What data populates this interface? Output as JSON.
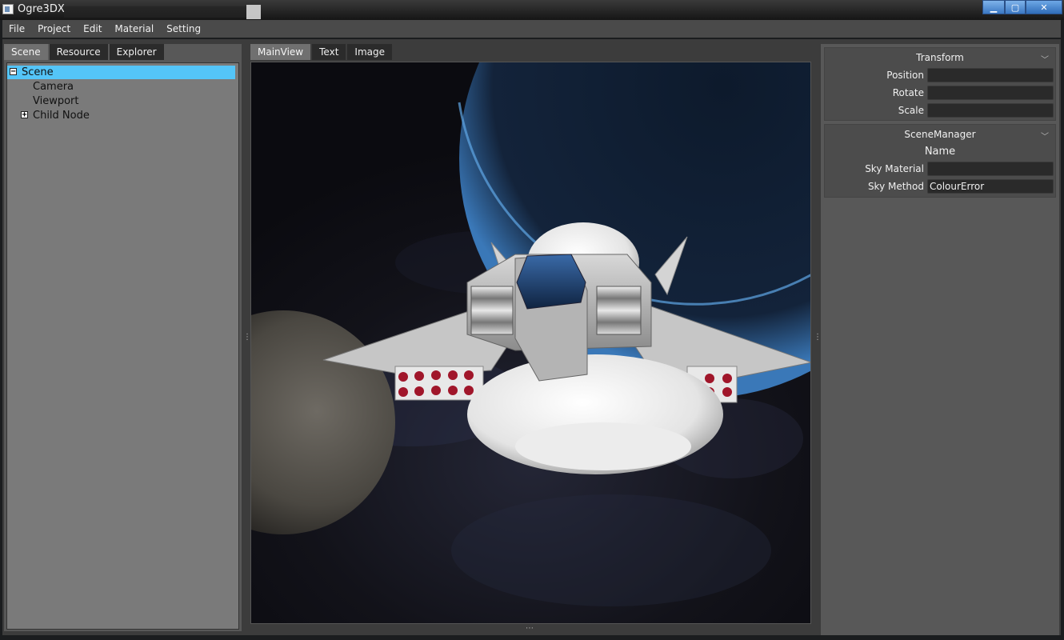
{
  "window": {
    "title": "Ogre3DX",
    "controls": {
      "minimize_icon": "minimize-icon",
      "maximize_icon": "maximize-icon",
      "close_icon": "close-icon",
      "close_glyph": "✕",
      "min_glyph": "▁",
      "max_glyph": "▢"
    }
  },
  "menu": [
    "File",
    "Project",
    "Edit",
    "Material",
    "Setting"
  ],
  "left_panel": {
    "tabs": [
      "Scene",
      "Resource",
      "Explorer"
    ],
    "active_tab": "Scene",
    "tree": [
      {
        "label": "Scene",
        "toggle": "−",
        "selected": true
      },
      {
        "label": "Camera"
      },
      {
        "label": "Viewport"
      },
      {
        "label": "Child Node",
        "toggle": "+"
      }
    ]
  },
  "center_panel": {
    "tabs": [
      "MainView",
      "Text",
      "Image"
    ],
    "active_tab": "MainView"
  },
  "right_panel": {
    "transform": {
      "title": "Transform",
      "fields": [
        {
          "label": "Position",
          "value": ""
        },
        {
          "label": "Rotate",
          "value": ""
        },
        {
          "label": "Scale",
          "value": ""
        }
      ]
    },
    "scene_manager": {
      "title": "SceneManager",
      "subtitle": "Name",
      "fields": [
        {
          "label": "Sky Material",
          "value": ""
        },
        {
          "label": "Sky Method",
          "value": "ColourError"
        }
      ]
    }
  },
  "colors": {
    "selection": "#54c5f8",
    "titlebar_buttons": "#4a88d0",
    "panel": "#585858"
  }
}
